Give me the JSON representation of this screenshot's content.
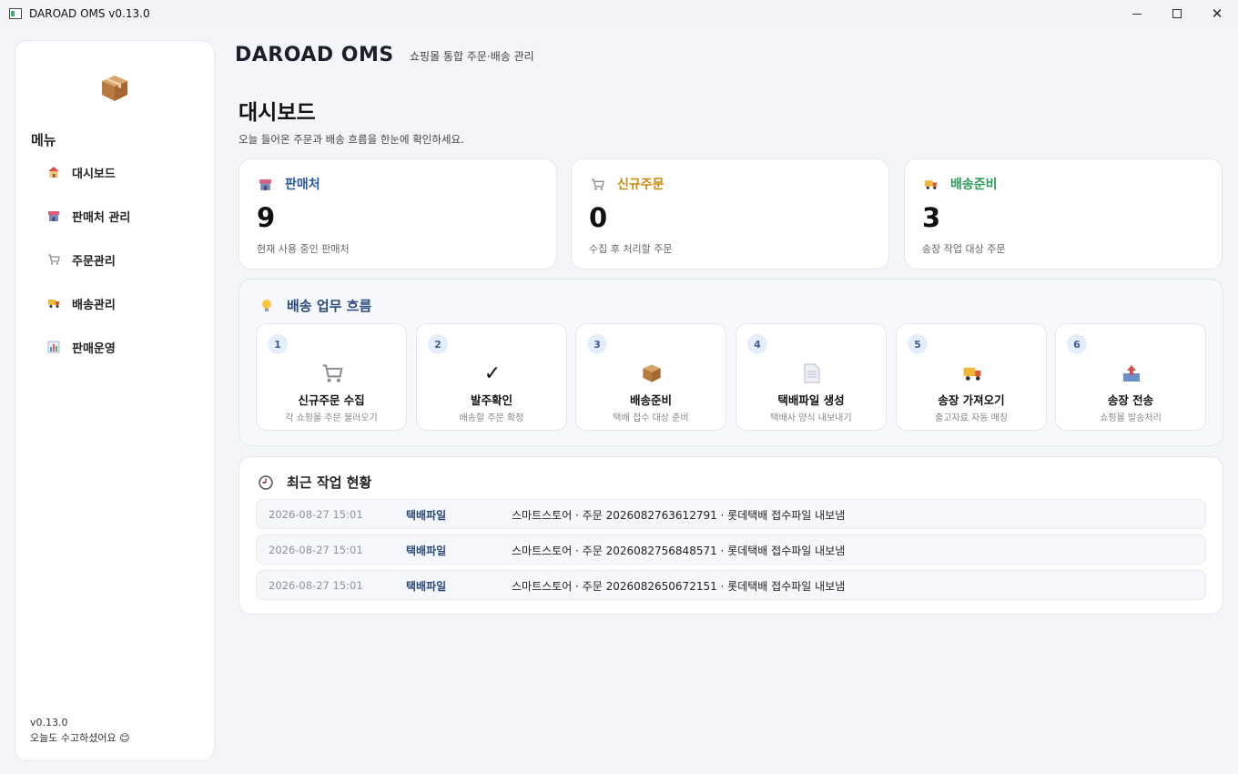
{
  "window": {
    "title": "DAROAD OMS v0.13.0"
  },
  "sidebar": {
    "menu_title": "메뉴",
    "items": [
      {
        "label": "대시보드",
        "icon": "house-icon"
      },
      {
        "label": "판매처 관리",
        "icon": "store-icon"
      },
      {
        "label": "주문관리",
        "icon": "cart-icon"
      },
      {
        "label": "배송관리",
        "icon": "truck-icon"
      },
      {
        "label": "판매운영",
        "icon": "chart-icon"
      }
    ],
    "version": "v0.13.0",
    "greeting": "오늘도 수고하셨어요 😊"
  },
  "header": {
    "app_name": "DAROAD OMS",
    "app_subtitle": "쇼핑몰 통합 주문·배송 관리"
  },
  "page": {
    "title": "대시보드",
    "description": "오늘 들어온 주문과 배송 흐름을 한눈에 확인하세요."
  },
  "stats": [
    {
      "label": "판매처",
      "value": "9",
      "note": "현재 사용 중인 판매처",
      "color": "#2b5aa0",
      "icon": "store-icon"
    },
    {
      "label": "신규주문",
      "value": "0",
      "note": "수집 후 처리할 주문",
      "color": "#c98a10",
      "icon": "cart-icon"
    },
    {
      "label": "배송준비",
      "value": "3",
      "note": "송장 작업 대상 주문",
      "color": "#2f9a5a",
      "icon": "truck-icon"
    }
  ],
  "workflow": {
    "title": "배송 업무 흐름",
    "steps": [
      {
        "num": "1",
        "name": "신규주문 수집",
        "desc": "각 쇼핑몰 주문 불러오기",
        "icon": "cart-icon"
      },
      {
        "num": "2",
        "name": "발주확인",
        "desc": "배송할 주문 확정",
        "icon": "check-icon"
      },
      {
        "num": "3",
        "name": "배송준비",
        "desc": "택배 접수 대상 준비",
        "icon": "package-icon"
      },
      {
        "num": "4",
        "name": "택배파일 생성",
        "desc": "택배사 양식 내보내기",
        "icon": "document-icon"
      },
      {
        "num": "5",
        "name": "송장 가져오기",
        "desc": "출고자료 자동 매칭",
        "icon": "truck-icon"
      },
      {
        "num": "6",
        "name": "송장 전송",
        "desc": "쇼핑몰 발송처리",
        "icon": "outbox-icon"
      }
    ]
  },
  "recent": {
    "title": "최근 작업 현황",
    "rows": [
      {
        "time": "2026-08-27 15:01",
        "type": "택배파일",
        "message": "스마트스토어 · 주문 2026082763612791 · 롯데택배 접수파일 내보냄"
      },
      {
        "time": "2026-08-27 15:01",
        "type": "택배파일",
        "message": "스마트스토어 · 주문 2026082756848571 · 롯데택배 접수파일 내보냄"
      },
      {
        "time": "2026-08-27 15:01",
        "type": "택배파일",
        "message": "스마트스토어 · 주문 2026082650672151 · 롯데택배 접수파일 내보냄"
      }
    ]
  }
}
